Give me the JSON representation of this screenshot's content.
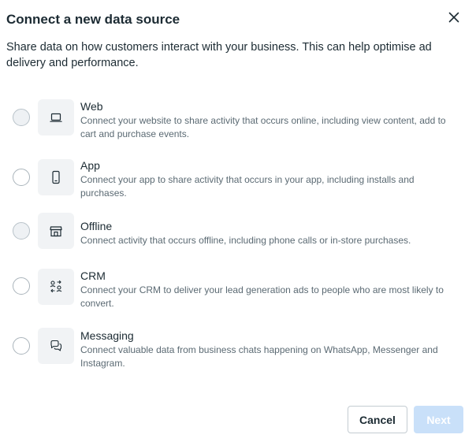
{
  "dialog": {
    "title": "Connect a new data source",
    "close_icon": "close-icon",
    "subtitle": "Share data on how customers interact with your business. This can help optimise ad delivery and performance."
  },
  "options": [
    {
      "title": "Web",
      "description": "Connect your website to share activity that occurs online, including view content, add to cart and purchase events.",
      "icon": "laptop-icon",
      "selected": false
    },
    {
      "title": "App",
      "description": "Connect your app to share activity that occurs in your app, including installs and purchases.",
      "icon": "mobile-phone-icon",
      "selected": false
    },
    {
      "title": "Offline",
      "description": "Connect activity that occurs offline, including phone calls or in-store purchases.",
      "icon": "store-icon",
      "selected": false
    },
    {
      "title": "CRM",
      "description": "Connect your CRM to deliver your lead generation ads to people who are most likely to convert.",
      "icon": "people-sync-icon",
      "selected": false
    },
    {
      "title": "Messaging",
      "description": "Connect valuable data from business chats happening on WhatsApp, Messenger and Instagram.",
      "icon": "chat-bubbles-icon",
      "selected": false
    }
  ],
  "footer": {
    "cancel_label": "Cancel",
    "next_label": "Next",
    "next_enabled": false
  },
  "colors": {
    "text_primary": "#1c2b33",
    "text_secondary": "#5b6a73",
    "icon_background": "#f1f3f5",
    "next_disabled_bg": "#c9e0f9"
  }
}
